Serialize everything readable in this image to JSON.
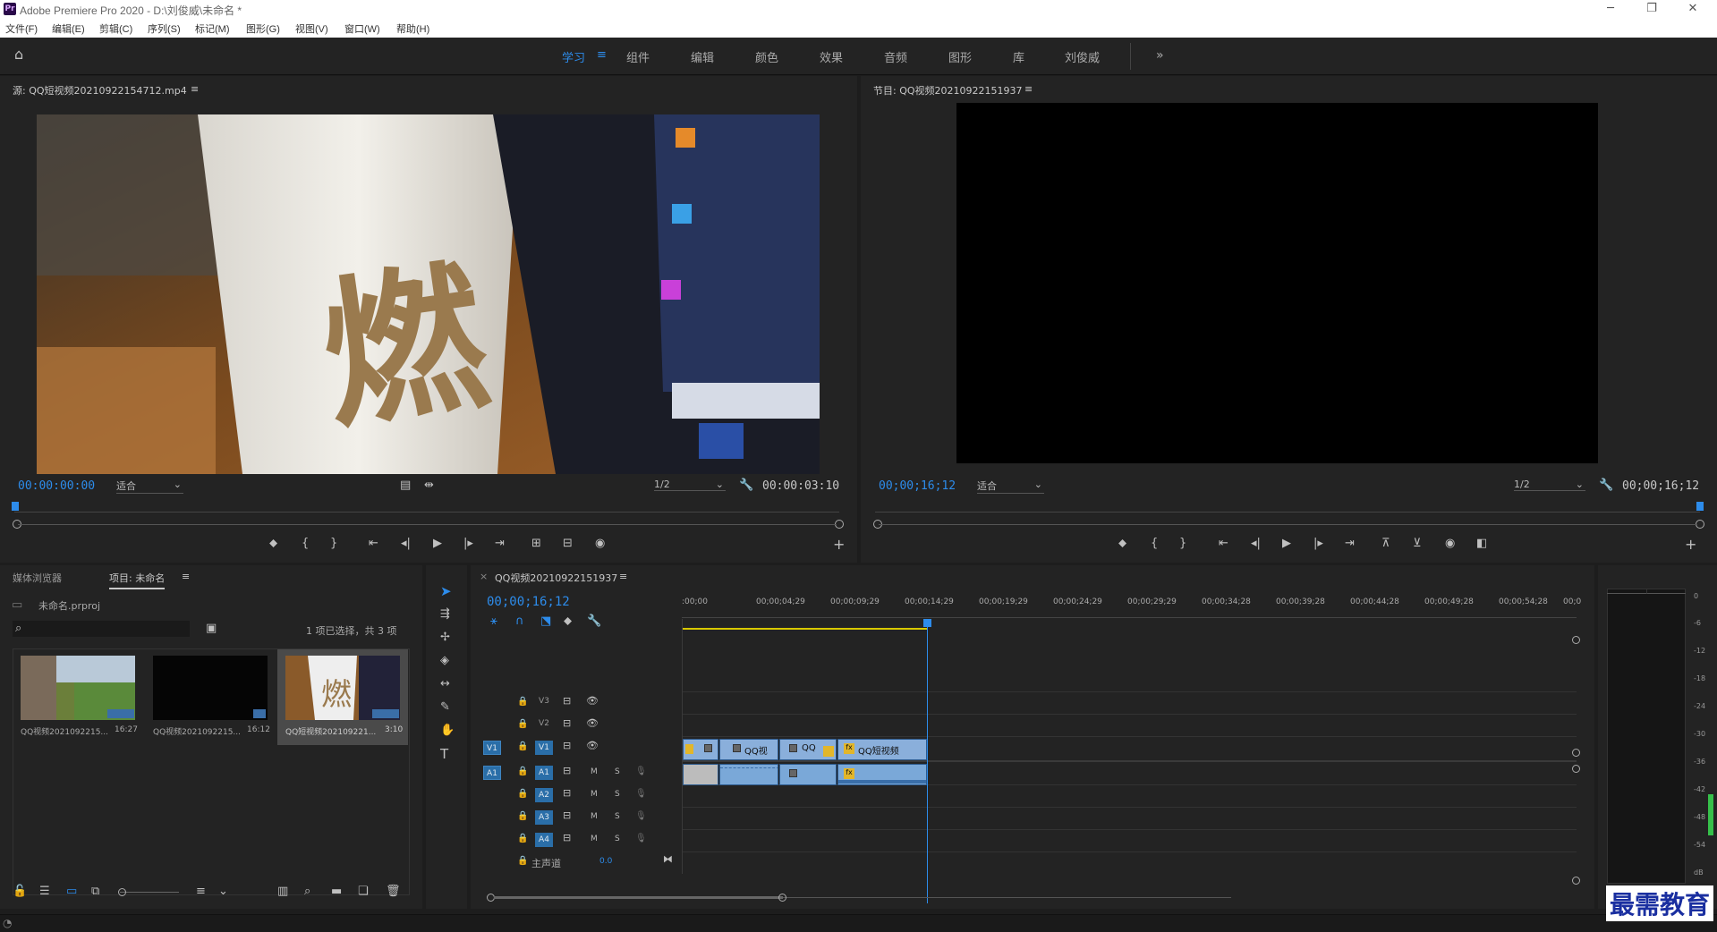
{
  "app": {
    "title": "Adobe Premiere Pro 2020 - D:\\刘俊威\\未命名 *",
    "logo": "Pr"
  },
  "menu": [
    "文件(F)",
    "编辑(E)",
    "剪辑(C)",
    "序列(S)",
    "标记(M)",
    "图形(G)",
    "视图(V)",
    "窗口(W)",
    "帮助(H)"
  ],
  "workspaces": [
    {
      "label": "学习",
      "active": true
    },
    {
      "label": "组件"
    },
    {
      "label": "编辑"
    },
    {
      "label": "颜色"
    },
    {
      "label": "效果"
    },
    {
      "label": "音频"
    },
    {
      "label": "图形"
    },
    {
      "label": "库"
    },
    {
      "label": "刘俊威"
    }
  ],
  "source_monitor": {
    "title": "源: QQ短视频20210922154712.mp4",
    "timecode": "00:00:00:00",
    "fit": "适合",
    "resolution": "1/2",
    "duration": "00:00:03:10"
  },
  "program_monitor": {
    "title": "节目: QQ视频20210922151937",
    "timecode": "00;00;16;12",
    "fit": "适合",
    "resolution": "1/2",
    "duration": "00;00;16;12"
  },
  "project_panel": {
    "tab_media": "媒体浏览器",
    "tab_project": "项目: 未命名",
    "file": "未命名.prproj",
    "selection": "1 项已选择，共 3 项",
    "items": [
      {
        "name": "QQ视频2021092215...",
        "duration": "16:27"
      },
      {
        "name": "QQ视频2021092215...",
        "duration": "16:12"
      },
      {
        "name": "QQ短视频202109221...",
        "duration": "3:10"
      }
    ]
  },
  "timeline": {
    "sequence": "QQ视频20210922151937",
    "timecode": "00;00;16;12",
    "ruler": [
      ":00;00",
      "00;00;04;29",
      "00;00;09;29",
      "00;00;14;29",
      "00;00;19;29",
      "00;00;24;29",
      "00;00;29;29",
      "00;00;34;28",
      "00;00;39;28",
      "00;00;44;28",
      "00;00;49;28",
      "00;00;54;28",
      "00;0"
    ],
    "video_tracks": [
      "V3",
      "V2",
      "V1"
    ],
    "audio_tracks": [
      "A1",
      "A2",
      "A3",
      "A4"
    ],
    "source_v": "V1",
    "source_a": "A1",
    "master_label": "主声道",
    "master_value": "0.0",
    "mute_label": "M",
    "solo_label": "S",
    "clips_v1": [
      "QQ视",
      "QQ",
      "QQ短视频"
    ],
    "fx_label": "fx"
  },
  "meter": {
    "scale": [
      "0",
      "-6",
      "-12",
      "-18",
      "-24",
      "-30",
      "-36",
      "-42",
      "-48",
      "-54",
      "dB"
    ]
  },
  "watermark": "最需教育"
}
